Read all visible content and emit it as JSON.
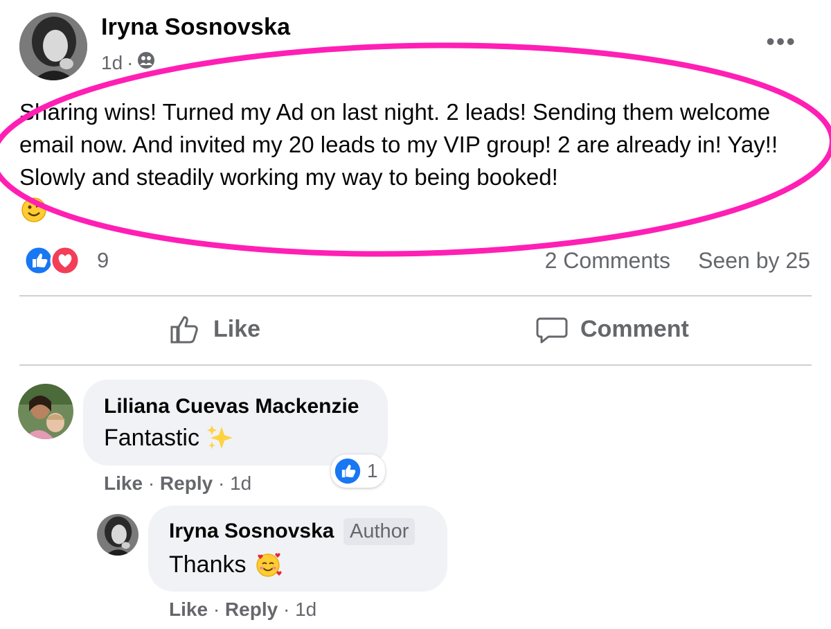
{
  "post": {
    "author": "Iryna Sosnovska",
    "time": "1d",
    "separator": "·",
    "text": "Sharing wins! Turned my Ad on last night. 2 leads! Sending them welcome email now. And invited my 20 leads to my VIP group! 2 are already in! Yay!! Slowly and steadily working my way to being booked!",
    "emoji": "wink-smile",
    "reactions": {
      "count": "9",
      "types": [
        "like",
        "love"
      ]
    },
    "comments_label": "2 Comments",
    "seen_by": "Seen by 25",
    "actions": {
      "like": "Like",
      "comment": "Comment"
    },
    "highlight_color": "#ff1fb4"
  },
  "comments": [
    {
      "author": "Liliana Cuevas Mackenzie",
      "text": "Fantastic",
      "emoji": "sparkles",
      "reaction_count": "1",
      "like": "Like",
      "reply": "Reply",
      "time": "1d"
    },
    {
      "author": "Iryna Sosnovska",
      "badge": "Author",
      "text": "Thanks",
      "emoji": "smiling-face-with-hearts",
      "like": "Like",
      "reply": "Reply",
      "time": "1d"
    }
  ],
  "colors": {
    "like_blue": "#1877f2",
    "love_red": "#f33e58",
    "secondary_text": "#65676b",
    "bubble_bg": "#f0f2f5"
  }
}
